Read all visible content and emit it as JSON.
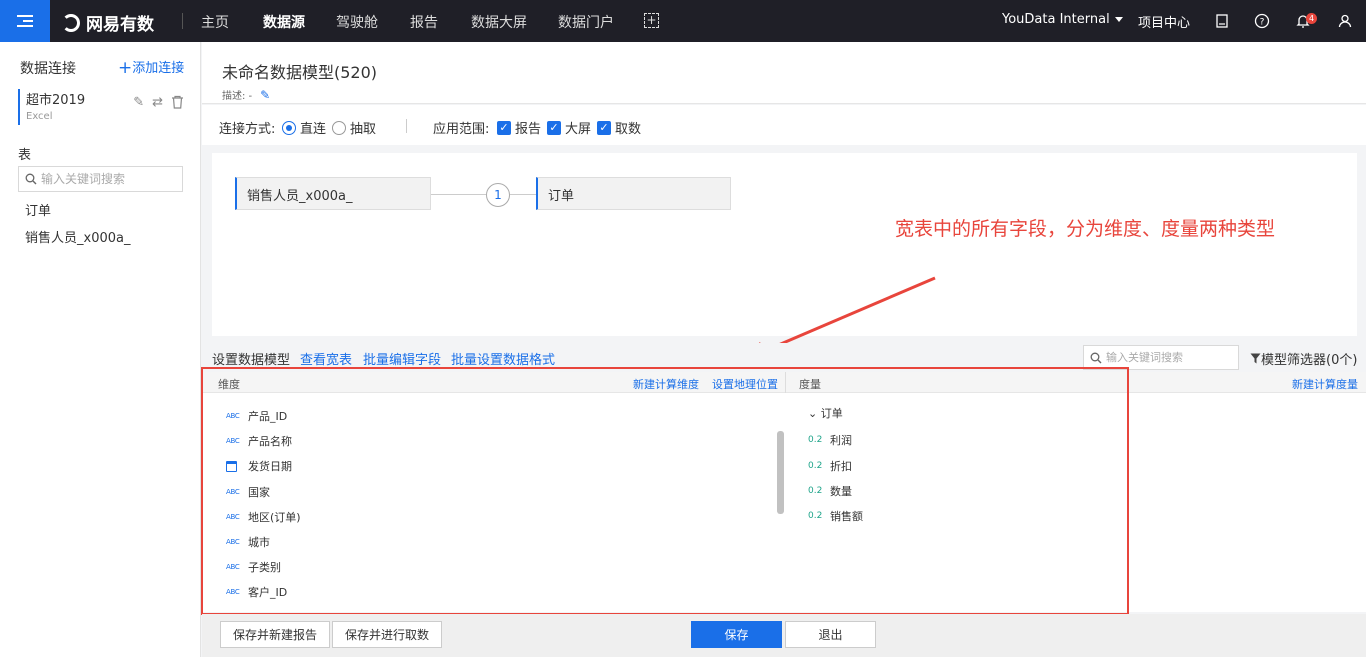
{
  "brand": "网易有数",
  "nav": {
    "items": [
      "主页",
      "数据源",
      "驾驶舱",
      "报告",
      "数据大屏",
      "数据门户"
    ],
    "active": "数据源",
    "org": "YouData Internal",
    "project_center": "项目中心",
    "notifications": "4"
  },
  "sidebar": {
    "title": "数据连接",
    "add_label": "添加连接",
    "connection": {
      "name": "超市2019",
      "type": "Excel"
    },
    "table_label": "表",
    "search_placeholder": "输入关键词搜索",
    "tables": [
      "订单",
      "销售人员_x000a_"
    ]
  },
  "model": {
    "title": "未命名数据模型(520)",
    "desc_label": "描述: -"
  },
  "options": {
    "mode_label": "连接方式:",
    "mode_direct": "直连",
    "mode_extract": "抽取",
    "scope_label": "应用范围:",
    "scope_report": "报告",
    "scope_screen": "大屏",
    "scope_fetch": "取数"
  },
  "canvas": {
    "left_table": "销售人员_x000a_",
    "right_table": "订单",
    "join_count": "1"
  },
  "annotation": "宽表中的所有字段，分为维度、度量两种类型",
  "toolbar": {
    "label": "设置数据模型",
    "view_wide": "查看宽表",
    "batch_edit": "批量编辑字段",
    "batch_format": "批量设置数据格式",
    "search_placeholder": "输入关键词搜索",
    "filter": "模型筛选器(0个)"
  },
  "fields": {
    "dim_header": "维度",
    "new_calc_dim": "新建计算维度",
    "geo": "设置地理位置",
    "measure_header": "度量",
    "new_calc_measure": "新建计算度量",
    "dimensions": [
      {
        "type": "ABC",
        "name": "产品_ID"
      },
      {
        "type": "ABC",
        "name": "产品名称"
      },
      {
        "type": "date",
        "name": "发货日期"
      },
      {
        "type": "ABC",
        "name": "国家"
      },
      {
        "type": "ABC",
        "name": "地区(订单)"
      },
      {
        "type": "ABC",
        "name": "城市"
      },
      {
        "type": "ABC",
        "name": "子类别"
      },
      {
        "type": "ABC",
        "name": "客户_ID"
      }
    ],
    "measure_group": "订单",
    "measures": [
      {
        "type": "0.2",
        "name": "利润"
      },
      {
        "type": "0.2",
        "name": "折扣"
      },
      {
        "type": "0.2",
        "name": "数量"
      },
      {
        "type": "0.2",
        "name": "销售额"
      }
    ]
  },
  "footer": {
    "save_new_report": "保存并新建报告",
    "save_fetch": "保存并进行取数",
    "save": "保存",
    "exit": "退出"
  },
  "colors": {
    "accent": "#1a6fe8",
    "annotation": "#e8453c",
    "nav_bg": "#1f1f27"
  }
}
